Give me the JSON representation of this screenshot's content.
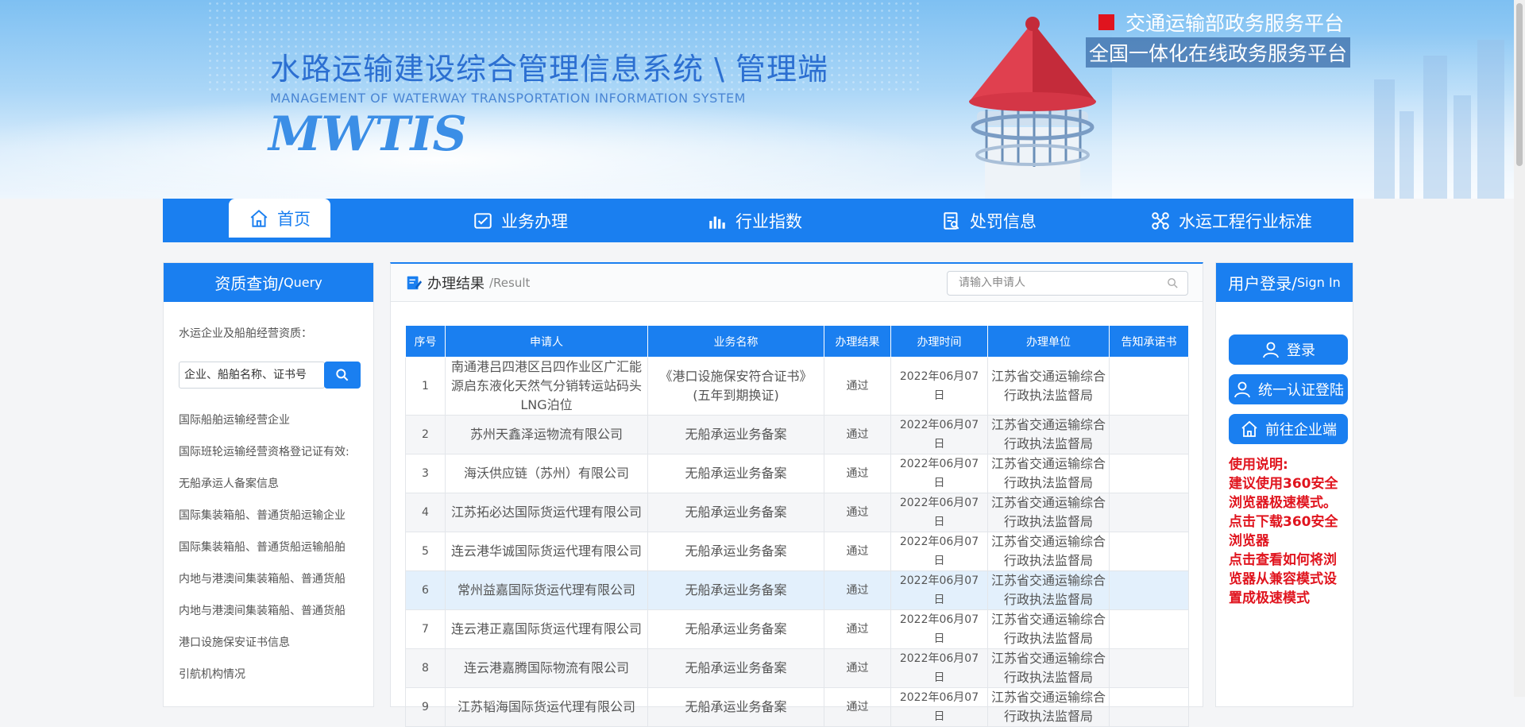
{
  "header": {
    "title": "水路运输建设综合管理信息系统 \\ 管理端",
    "subtitle": "MANAGEMENT OF WATERWAY TRANSPORTATION INFORMATION SYSTEM",
    "abbr": "MWTIS",
    "platform1": "交通运输部政务服务平台",
    "platform2": "全国一体化在线政务服务平台"
  },
  "nav": {
    "items": [
      {
        "label": "首页",
        "icon": "home-icon"
      },
      {
        "label": "业务办理",
        "icon": "checklist-icon"
      },
      {
        "label": "行业指数",
        "icon": "bar-chart-icon"
      },
      {
        "label": "处罚信息",
        "icon": "document-search-icon"
      },
      {
        "label": "水运工程行业标准",
        "icon": "network-icon"
      }
    ]
  },
  "left": {
    "title": "资质查询/",
    "title_en": "Query",
    "label": "水运企业及船舶经营资质：",
    "search_value": "企业、船舶名称、证书号",
    "links": [
      "国际船舶运输经营企业",
      "国际班轮运输经营资格登记证有效:",
      "无船承运人备案信息",
      "国际集装箱船、普通货船运输企业",
      "国际集装箱船、普通货船运输船舶",
      "内地与港澳间集装箱船、普通货船",
      "内地与港澳间集装箱船、普通货船",
      "港口设施保安证书信息",
      "引航机构情况"
    ]
  },
  "center": {
    "title": "办理结果",
    "title_en": "/Result",
    "search_placeholder": "请输入申请人",
    "columns": [
      "序号",
      "申请人",
      "业务名称",
      "办理结果",
      "办理时间",
      "办理单位",
      "告知承诺书"
    ],
    "rows": [
      {
        "no": "1",
        "applicant": "南通港吕四港区吕四作业区广汇能源启东液化天然气分销转运站码头LNG泊位",
        "business": "《港口设施保安符合证书》(五年到期换证)",
        "result": "通过",
        "time": "2022年06月07日",
        "unit": "江苏省交通运输综合行政执法监督局",
        "letter": ""
      },
      {
        "no": "2",
        "applicant": "苏州天鑫泽运物流有限公司",
        "business": "无船承运业务备案",
        "result": "通过",
        "time": "2022年06月07日",
        "unit": "江苏省交通运输综合行政执法监督局",
        "letter": ""
      },
      {
        "no": "3",
        "applicant": "海沃供应链（苏州）有限公司",
        "business": "无船承运业务备案",
        "result": "通过",
        "time": "2022年06月07日",
        "unit": "江苏省交通运输综合行政执法监督局",
        "letter": ""
      },
      {
        "no": "4",
        "applicant": "江苏拓必达国际货运代理有限公司",
        "business": "无船承运业务备案",
        "result": "通过",
        "time": "2022年06月07日",
        "unit": "江苏省交通运输综合行政执法监督局",
        "letter": ""
      },
      {
        "no": "5",
        "applicant": "连云港华诚国际货运代理有限公司",
        "business": "无船承运业务备案",
        "result": "通过",
        "time": "2022年06月07日",
        "unit": "江苏省交通运输综合行政执法监督局",
        "letter": ""
      },
      {
        "no": "6",
        "applicant": "常州益嘉国际货运代理有限公司",
        "business": "无船承运业务备案",
        "result": "通过",
        "time": "2022年06月07日",
        "unit": "江苏省交通运输综合行政执法监督局",
        "letter": ""
      },
      {
        "no": "7",
        "applicant": "连云港正嘉国际货运代理有限公司",
        "business": "无船承运业务备案",
        "result": "通过",
        "time": "2022年06月07日",
        "unit": "江苏省交通运输综合行政执法监督局",
        "letter": ""
      },
      {
        "no": "8",
        "applicant": "连云港嘉腾国际物流有限公司",
        "business": "无船承运业务备案",
        "result": "通过",
        "time": "2022年06月07日",
        "unit": "江苏省交通运输综合行政执法监督局",
        "letter": ""
      },
      {
        "no": "9",
        "applicant": "江苏韬海国际货运代理有限公司",
        "business": "无船承运业务备案",
        "result": "通过",
        "time": "2022年06月07日",
        "unit": "江苏省交通运输综合行政执法监督局",
        "letter": ""
      }
    ]
  },
  "right": {
    "title": "用户登录/",
    "title_en": "Sign In",
    "login": "登录",
    "unified": "统一认证登陆",
    "enterprise": "前往企业端",
    "note_title": "使用说明:",
    "note1": "建议使用360安全浏览器极速模式。",
    "note2": "点击下载360安全浏览器",
    "note3": "点击查看如何将浏览器从兼容模式设置成极速模式"
  },
  "colors": {
    "primary": "#1a7ff0",
    "alert": "#e0141e"
  }
}
